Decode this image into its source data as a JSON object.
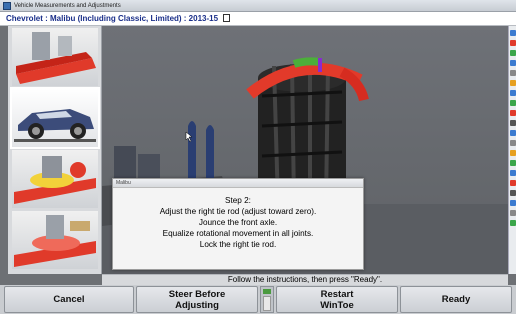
{
  "window": {
    "title": "Vehicle Measurements and Adjustments"
  },
  "vehicle": {
    "label": "Chevrolet : Malibu (Including Classic, Limited) : 2013-15"
  },
  "dialog": {
    "title": "Malibu",
    "heading": "Step 2:",
    "lines": [
      "Adjust the right tie rod (adjust toward zero).",
      "Jounce the front axle.",
      "Equalize rotational movement in all joints.",
      "Lock the right tie rod."
    ]
  },
  "status": {
    "text": "Follow the instructions, then press \"Ready\"."
  },
  "buttons": {
    "cancel": "Cancel",
    "steer_line1": "Steer Before",
    "steer_line2": "Adjusting",
    "restart_line1": "Restart",
    "restart_line2": "WinToe",
    "ready": "Ready"
  },
  "colors": {
    "accent_red": "#e23a2a",
    "accent_green": "#4caf3a",
    "vehicle_text": "#1a2f8a"
  }
}
